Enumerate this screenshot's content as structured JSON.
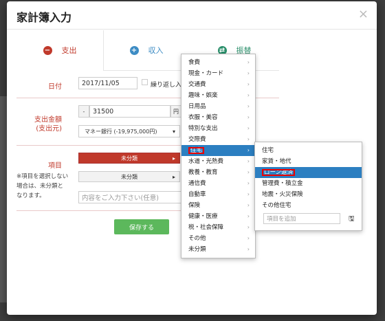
{
  "modal": {
    "title": "家計簿入力",
    "close_label": "×"
  },
  "tabs": {
    "expense": "支出",
    "income": "収入",
    "transfer": "振替"
  },
  "form": {
    "date_label": "日付",
    "date_value": "2017/11/05",
    "repeat_label": "繰り返し入",
    "amount_label": "支出金額",
    "amount_sub_label": "(支出元)",
    "minus_label": "-",
    "amount_value": "31500",
    "currency_label": "円",
    "account_value": "マネー銀行 (-19,975,000円)",
    "item_label": "項目",
    "category_value": "未分類",
    "subcategory_value": "未分類",
    "memo_placeholder": "内容をご入力下さい(任意)",
    "note": "※項目を選択しない場合は、未分類となります。",
    "save_label": "保存する"
  },
  "category_menu": [
    "食費",
    "現金・カード",
    "交通費",
    "趣味・娯楽",
    "日用品",
    "衣服・美容",
    "特別な支出",
    "交際費",
    "住宅",
    "水道・光熱費",
    "教養・教育",
    "通信費",
    "自動車",
    "保険",
    "健康・医療",
    "税・社会保障",
    "その他",
    "未分類"
  ],
  "subcategory_menu": {
    "items": [
      "住宅",
      "家賃・地代",
      "ローン返済",
      "管理費・積立金",
      "地震・火災保険",
      "その他住宅"
    ],
    "add_placeholder": "項目を追加",
    "save_icon": "floppy-icon"
  },
  "colors": {
    "expense": "#c0392b",
    "income": "#3d8cc4",
    "transfer": "#2b8f6b",
    "save": "#5cb85c",
    "selected": "#2c7fc1"
  }
}
